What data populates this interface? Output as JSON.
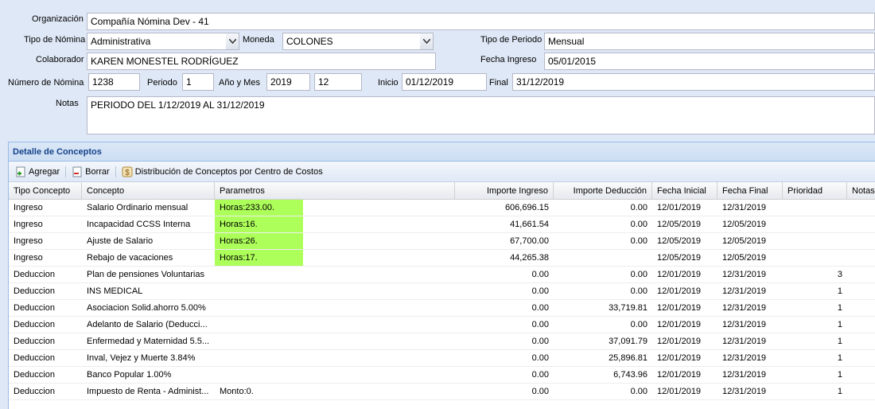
{
  "form": {
    "organizacion_label": "Organización",
    "organizacion_value": "Compañía Nómina Dev - 41",
    "tipo_nomina_label": "Tipo de Nómina",
    "tipo_nomina_value": "Administrativa",
    "moneda_label": "Moneda",
    "moneda_value": "COLONES",
    "tipo_periodo_label": "Tipo de Periodo",
    "tipo_periodo_value": "Mensual",
    "colaborador_label": "Colaborador",
    "colaborador_value": "KAREN MONESTEL RODRÍGUEZ",
    "fecha_ingreso_label": "Fecha Ingreso",
    "fecha_ingreso_value": "05/01/2015",
    "numero_nomina_label": "Número de Nómina",
    "numero_nomina_value": "1238",
    "periodo_label": "Periodo",
    "periodo_value": "1",
    "anio_mes_label": "Año y Mes",
    "anio_value": "2019",
    "mes_value": "12",
    "inicio_label": "Inicio",
    "inicio_value": "01/12/2019",
    "final_label": "Final",
    "final_value": "31/12/2019",
    "notas_label": "Notas",
    "notas_value": "PERIODO DEL 1/12/2019 AL 31/12/2019"
  },
  "detalle": {
    "title": "Detalle de Conceptos",
    "toolbar": {
      "agregar": "Agregar",
      "borrar": "Borrar",
      "distribucion": "Distribución de Conceptos por Centro de Costos"
    },
    "columns": [
      "Tipo Concepto",
      "Concepto",
      "Parametros",
      "Importe Ingreso",
      "Importe Deducción",
      "Fecha Inicial",
      "Fecha Final",
      "Prioridad",
      "Notas"
    ],
    "rows": [
      {
        "tipo": "Ingreso",
        "concepto": "Salario Ordinario mensual",
        "param": "Horas:233.00.",
        "hl": true,
        "ingreso": "606,696.15",
        "deduccion": "0.00",
        "fi": "12/01/2019",
        "ff": "12/31/2019",
        "prioridad": "",
        "notas": ""
      },
      {
        "tipo": "Ingreso",
        "concepto": "Incapacidad CCSS Interna",
        "param": "Horas:16.",
        "hl": true,
        "ingreso": "41,661.54",
        "deduccion": "0.00",
        "fi": "12/05/2019",
        "ff": "12/05/2019",
        "prioridad": "",
        "notas": ""
      },
      {
        "tipo": "Ingreso",
        "concepto": "Ajuste de Salario",
        "param": "Horas:26.",
        "hl": true,
        "ingreso": "67,700.00",
        "deduccion": "0.00",
        "fi": "12/05/2019",
        "ff": "12/05/2019",
        "prioridad": "",
        "notas": ""
      },
      {
        "tipo": "Ingreso",
        "concepto": "Rebajo de vacaciones",
        "param": "Horas:17.",
        "hl": true,
        "ingreso": "44,265.38",
        "deduccion": "",
        "fi": "12/05/2019",
        "ff": "12/05/2019",
        "prioridad": "",
        "notas": ""
      },
      {
        "tipo": "Deduccion",
        "concepto": "Plan de pensiones Voluntarias",
        "param": "",
        "hl": false,
        "ingreso": "0.00",
        "deduccion": "0.00",
        "fi": "12/01/2019",
        "ff": "12/31/2019",
        "prioridad": "3",
        "notas": ""
      },
      {
        "tipo": "Deduccion",
        "concepto": "INS MEDICAL",
        "param": "",
        "hl": false,
        "ingreso": "0.00",
        "deduccion": "0.00",
        "fi": "12/01/2019",
        "ff": "12/31/2019",
        "prioridad": "1",
        "notas": ""
      },
      {
        "tipo": "Deduccion",
        "concepto": "Asociacion Solid.ahorro 5.00%",
        "param": "",
        "hl": false,
        "ingreso": "0.00",
        "deduccion": "33,719.81",
        "fi": "12/01/2019",
        "ff": "12/31/2019",
        "prioridad": "1",
        "notas": ""
      },
      {
        "tipo": "Deduccion",
        "concepto": "Adelanto de Salario (Deducci...",
        "param": "",
        "hl": false,
        "ingreso": "0.00",
        "deduccion": "0.00",
        "fi": "12/01/2019",
        "ff": "12/31/2019",
        "prioridad": "1",
        "notas": ""
      },
      {
        "tipo": "Deduccion",
        "concepto": "Enfermedad y Maternidad 5.5...",
        "param": "",
        "hl": false,
        "ingreso": "0.00",
        "deduccion": "37,091.79",
        "fi": "12/01/2019",
        "ff": "12/31/2019",
        "prioridad": "1",
        "notas": ""
      },
      {
        "tipo": "Deduccion",
        "concepto": "Inval, Vejez y Muerte 3.84%",
        "param": "",
        "hl": false,
        "ingreso": "0.00",
        "deduccion": "25,896.81",
        "fi": "12/01/2019",
        "ff": "12/31/2019",
        "prioridad": "1",
        "notas": ""
      },
      {
        "tipo": "Deduccion",
        "concepto": "Banco Popular 1.00%",
        "param": "",
        "hl": false,
        "ingreso": "0.00",
        "deduccion": "6,743.96",
        "fi": "12/01/2019",
        "ff": "12/31/2019",
        "prioridad": "1",
        "notas": ""
      },
      {
        "tipo": "Deduccion",
        "concepto": "Impuesto de Renta - Administ...",
        "param": "Monto:0.",
        "hl": false,
        "ingreso": "0.00",
        "deduccion": "0.00",
        "fi": "12/01/2019",
        "ff": "12/31/2019",
        "prioridad": "1",
        "notas": ""
      }
    ]
  }
}
